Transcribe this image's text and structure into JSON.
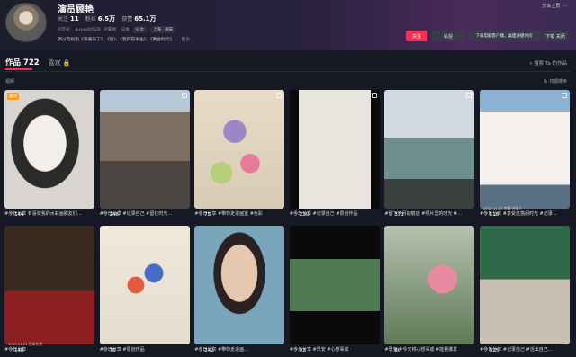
{
  "profile": {
    "name": "演员顾艳",
    "stats": [
      {
        "label": "关注",
        "value": "11"
      },
      {
        "label": "粉丝",
        "value": "6.5万"
      },
      {
        "label": "获赞",
        "value": "65.1万"
      }
    ],
    "douyin_id": "抖音号： guyan00528",
    "ip": "IP属地： 日本",
    "tags": [
      "♀ 女",
      "上海 · 静安"
    ],
    "bio": "演过电视剧《婆婆来了》、《碰》、《我的前半生》、《黄金时代》…",
    "bio_more": "更多"
  },
  "header_actions": {
    "share": "分享主页",
    "more": "···",
    "follow": "关注",
    "message": "私信",
    "download": "下载电脑客户端，桌面快捷访问",
    "close": "下载 关闭"
  },
  "tabs": {
    "works": "作品 722",
    "likes": "喜欢 🔒"
  },
  "search_placeholder": "搜索 Ta 的作品",
  "section_label": "视频",
  "sort_label": "日期排序",
  "videos": [
    {
      "likes": "144",
      "caption": "#今日分享 有喜欢我的水彩画朋友们…",
      "badge": "置顶",
      "multi": false
    },
    {
      "likes": "246",
      "caption": "#今日分享 #记录自己 #留住时光…",
      "badge": "",
      "multi": true
    },
    {
      "likes": "75",
      "caption": "#今日分享 #带你走进画室 #色彩",
      "badge": "",
      "multi": true
    },
    {
      "likes": "230",
      "caption": "#今日分享 #记录自己 #原创作品",
      "badge": "",
      "multi": true
    },
    {
      "likes": "373",
      "caption": "#留下岁月的痕迹 #照片里的时光 #…",
      "badge": "",
      "multi": true
    },
    {
      "likes": "118",
      "caption": "#今日分享 #享受这悠闲时光 #记录…",
      "badge": "",
      "multi": true,
      "date": "2019.11.03 宫崎 外国人"
    },
    {
      "likes": "148",
      "caption": "#今日分享",
      "badge": "",
      "multi": false,
      "date": "2020.01.21 日本东京"
    },
    {
      "likes": "76",
      "caption": "#今日分享 #原创作品",
      "badge": "",
      "multi": false
    },
    {
      "likes": "242",
      "caption": "#今日分享 #带你走进画…",
      "badge": "",
      "multi": false
    },
    {
      "likes": "93",
      "caption": "#今日分享 #早安 #心想事成",
      "badge": "",
      "multi": false
    },
    {
      "likes": "86",
      "caption": "#早安 #今天将心想事成 #能量爆发",
      "badge": "",
      "multi": false
    },
    {
      "likes": "325",
      "caption": "#今日分享 #记录自己 #活出自己…",
      "badge": "",
      "multi": false
    }
  ]
}
